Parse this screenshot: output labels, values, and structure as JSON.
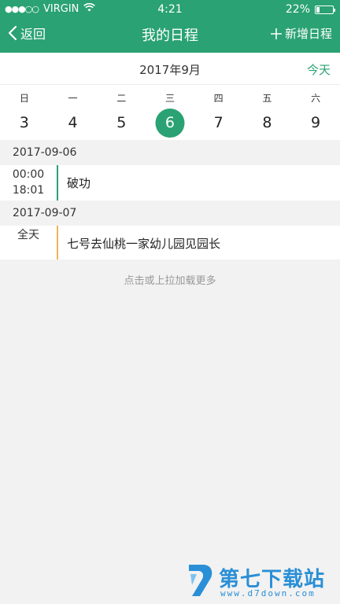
{
  "status_bar": {
    "signal_dots": "●●●○○",
    "carrier": "VIRGIN",
    "time": "4:21",
    "battery_text": "22%",
    "battery_level": 0.22
  },
  "nav": {
    "back_label": "返回",
    "title": "我的日程",
    "add_label": "新增日程"
  },
  "calendar": {
    "month_label": "2017年9月",
    "today_label": "今天",
    "weekdays": [
      "日",
      "一",
      "二",
      "三",
      "四",
      "五",
      "六"
    ],
    "dates": [
      "3",
      "4",
      "5",
      "6",
      "7",
      "8",
      "9"
    ],
    "selected_index": 3
  },
  "sections": [
    {
      "date": "2017-09-06",
      "events": [
        {
          "time_start": "00:00",
          "time_end": "18:01",
          "title": "破功",
          "color": "#2aa273"
        }
      ]
    },
    {
      "date": "2017-09-07",
      "events": [
        {
          "time_start": "全天",
          "time_end": "",
          "title": "七号去仙桃一家幼儿园见园长",
          "color": "#f0b35a"
        }
      ]
    }
  ],
  "load_more": "点击或上拉加载更多",
  "watermark": {
    "title": "第七下载站",
    "url": "www.d7down.com"
  },
  "colors": {
    "primary": "#2aa273",
    "accent_orange": "#f0b35a",
    "watermark_blue": "#2a8fd6"
  }
}
